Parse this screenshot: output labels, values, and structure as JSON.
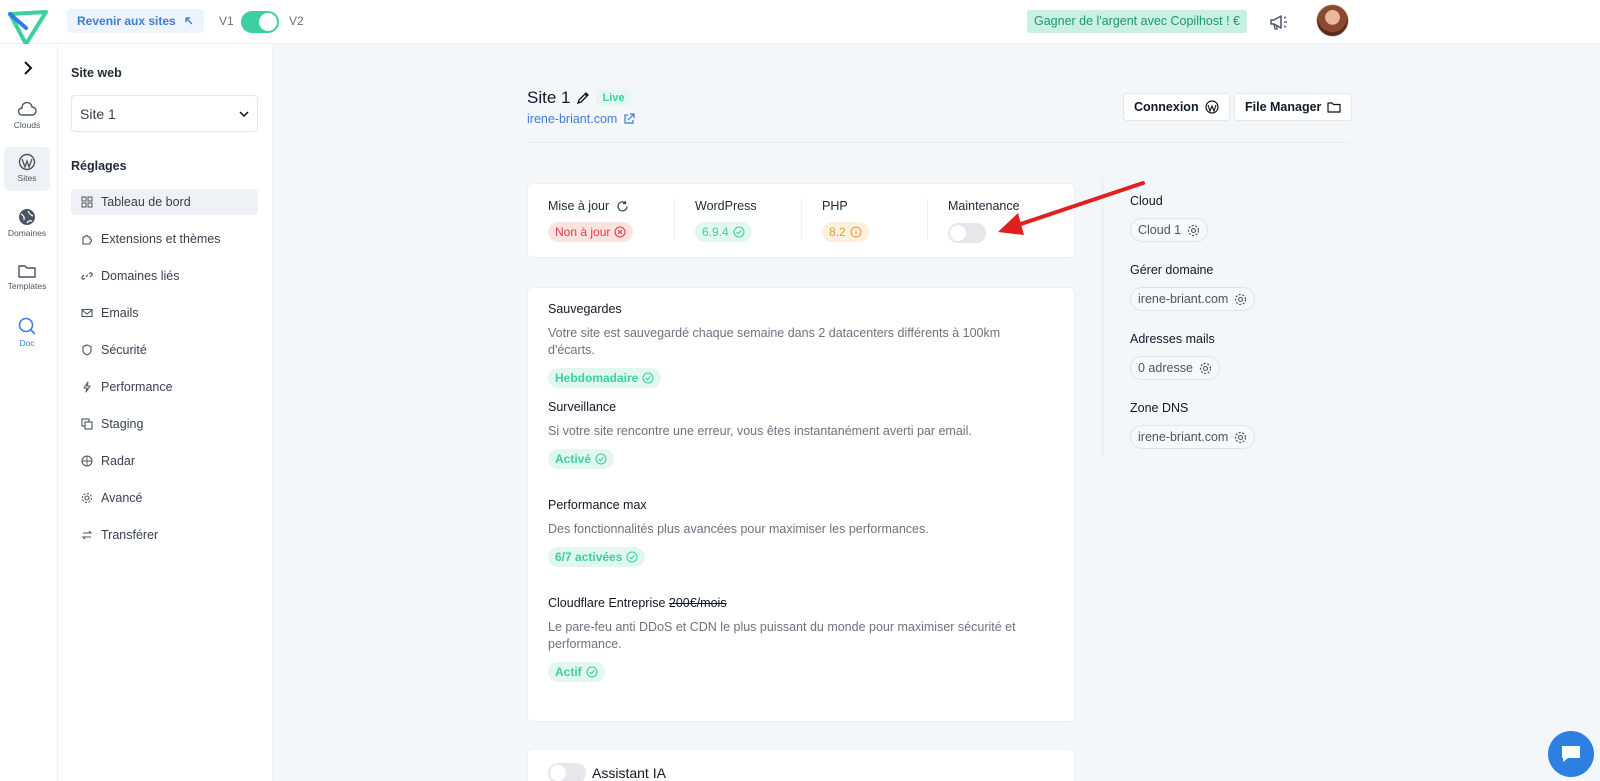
{
  "topbar": {
    "back_label": "Revenir aux sites",
    "v1": "V1",
    "v2": "V2",
    "earn_label": "Gagner de l'argent avec Copilhost ! €"
  },
  "rail": {
    "items": [
      {
        "label": "Clouds",
        "icon": "cloud-icon"
      },
      {
        "label": "Sites",
        "icon": "wordpress-icon"
      },
      {
        "label": "Domaines",
        "icon": "globe-icon"
      },
      {
        "label": "Templates",
        "icon": "folder-icon"
      },
      {
        "label": "Doc",
        "icon": "search-icon"
      }
    ]
  },
  "sidebar": {
    "site_heading": "Site web",
    "site_selected": "Site 1",
    "settings_heading": "Réglages",
    "items": [
      {
        "label": "Tableau de bord",
        "icon": "dashboard-icon"
      },
      {
        "label": "Extensions et thèmes",
        "icon": "puzzle-icon"
      },
      {
        "label": "Domaines liés",
        "icon": "link-icon"
      },
      {
        "label": "Emails",
        "icon": "mail-icon"
      },
      {
        "label": "Sécurité",
        "icon": "shield-icon"
      },
      {
        "label": "Performance",
        "icon": "bolt-icon"
      },
      {
        "label": "Staging",
        "icon": "copy-icon"
      },
      {
        "label": "Radar",
        "icon": "radar-icon"
      },
      {
        "label": "Avancé",
        "icon": "gear-icon"
      },
      {
        "label": "Transférer",
        "icon": "transfer-icon"
      }
    ]
  },
  "site": {
    "title": "Site 1",
    "status": "Live",
    "url": "irene-briant.com"
  },
  "header_buttons": {
    "login": "Connexion",
    "file_manager": "File Manager"
  },
  "status": {
    "update_label": "Mise à jour",
    "update_value": "Non à jour",
    "wp_label": "WordPress",
    "wp_value": "6.9.4",
    "php_label": "PHP",
    "php_value": "8.2",
    "maintenance_label": "Maintenance"
  },
  "features": [
    {
      "title": "Sauvegardes",
      "desc": "Votre site est sauvegardé chaque semaine dans 2 datacenters différents à 100km d'écarts.",
      "badge": "Hebdomadaire"
    },
    {
      "title": "Surveillance",
      "desc": "Si votre site rencontre une erreur, vous êtes instantanément averti par email.",
      "badge": "Activé"
    },
    {
      "title": "Performance max",
      "desc": "Des fonctionnalités plus avancées pour maximiser les performances.",
      "badge": "6/7 activées"
    },
    {
      "title": "Cloudflare Entreprise",
      "strike": "200€/mois",
      "desc": "Le pare-feu anti DDoS et CDN le plus puissant du monde pour maximiser sécurité et performance.",
      "badge": "Actif"
    }
  ],
  "right_panel": [
    {
      "title": "Cloud",
      "chip": "Cloud 1"
    },
    {
      "title": "Gérer domaine",
      "chip": "irene-briant.com"
    },
    {
      "title": "Adresses mails",
      "chip": "0 adresse"
    },
    {
      "title": "Zone DNS",
      "chip": "irene-briant.com"
    }
  ],
  "assistant": {
    "label": "Assistant IA"
  },
  "colors": {
    "accent": "#3ccfa0",
    "link": "#3b7dd8",
    "error": "#e03e3e",
    "warning": "#f09a2c",
    "annotation": "#e02020"
  }
}
